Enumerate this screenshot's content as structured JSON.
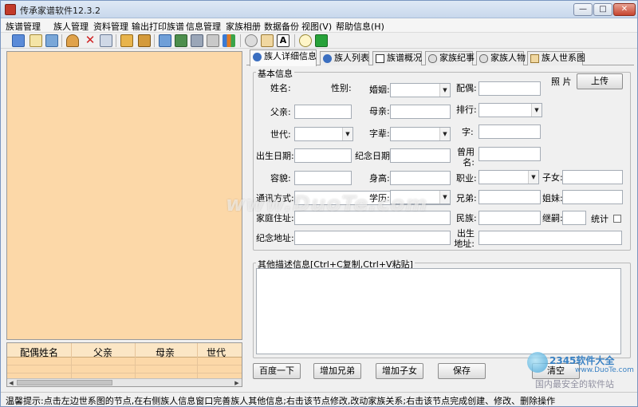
{
  "window": {
    "title": "传承家谱软件12.3.2",
    "min_glyph": "—",
    "max_glyph": "□",
    "close_glyph": "✕"
  },
  "menu": [
    "族谱管理",
    "族人管理",
    "资料管理",
    "输出打印族谱",
    "信息管理",
    "家族相册",
    "数据备份",
    "视图(V)",
    "帮助信息(H)"
  ],
  "toolbar": {
    "icons": [
      "new-icon",
      "book-icon",
      "export-icon",
      "add-person-icon",
      "delete-icon",
      "edit-icon",
      "search-icon",
      "binoculars-icon",
      "print-icon",
      "tree-icon",
      "settings-gear-icon",
      "chart-icon",
      "link-icon",
      "album-icon",
      "text-icon",
      "chat-icon",
      "exit-icon"
    ]
  },
  "left_table": {
    "columns": [
      "配偶姓名",
      "父亲",
      "母亲",
      "世代"
    ]
  },
  "tabs": [
    "族人详细信息",
    "族人列表",
    "族谱概况",
    "家族纪事",
    "家族人物",
    "族人世系图"
  ],
  "basic_info": {
    "title": "基本信息",
    "labels": {
      "name": "姓名:",
      "gender": "性别:",
      "marriage": "婚姻:",
      "spouse": "配偶:",
      "photo": "照 片",
      "father": "父亲:",
      "mother": "母亲:",
      "rank": "排行:",
      "generation": "世代:",
      "generation_char": "字辈:",
      "courtesy": "字:",
      "birth_date": "出生日期:",
      "memorial_date": "纪念日期:",
      "former_name": "曾用名:",
      "appearance": "容貌:",
      "height": "身高:",
      "job": "职业:",
      "children": "子女:",
      "contact": "通讯方式:",
      "education": "学历:",
      "brothers": "兄弟:",
      "sisters": "姐妹:",
      "address": "家庭住址:",
      "ethnicity": "民族:",
      "adopt": "继嗣:",
      "stats": "统计",
      "memorial_addr": "纪念地址:",
      "birth_addr": "出生地址:"
    },
    "upload_button": "上传"
  },
  "other_info": {
    "title": "其他描述信息[Ctrl+C复制,Ctrl+V粘贴]"
  },
  "buttons": {
    "baidu": "百度一下",
    "add_brother": "增加兄弟",
    "add_child": "增加子女",
    "save": "保存",
    "clear": "清空"
  },
  "status": "温馨提示:点击左边世系图的节点,在右侧族人信息窗口完善族人其他信息;右击该节点修改,改动家族关系;右击该节点完成创建、修改、删除操作",
  "watermark": "www.DuoTe.com",
  "corner_brand": {
    "main": "2345软件大全",
    "url": "www.DuoTe.com",
    "slogan": "国内最安全的软件站"
  }
}
